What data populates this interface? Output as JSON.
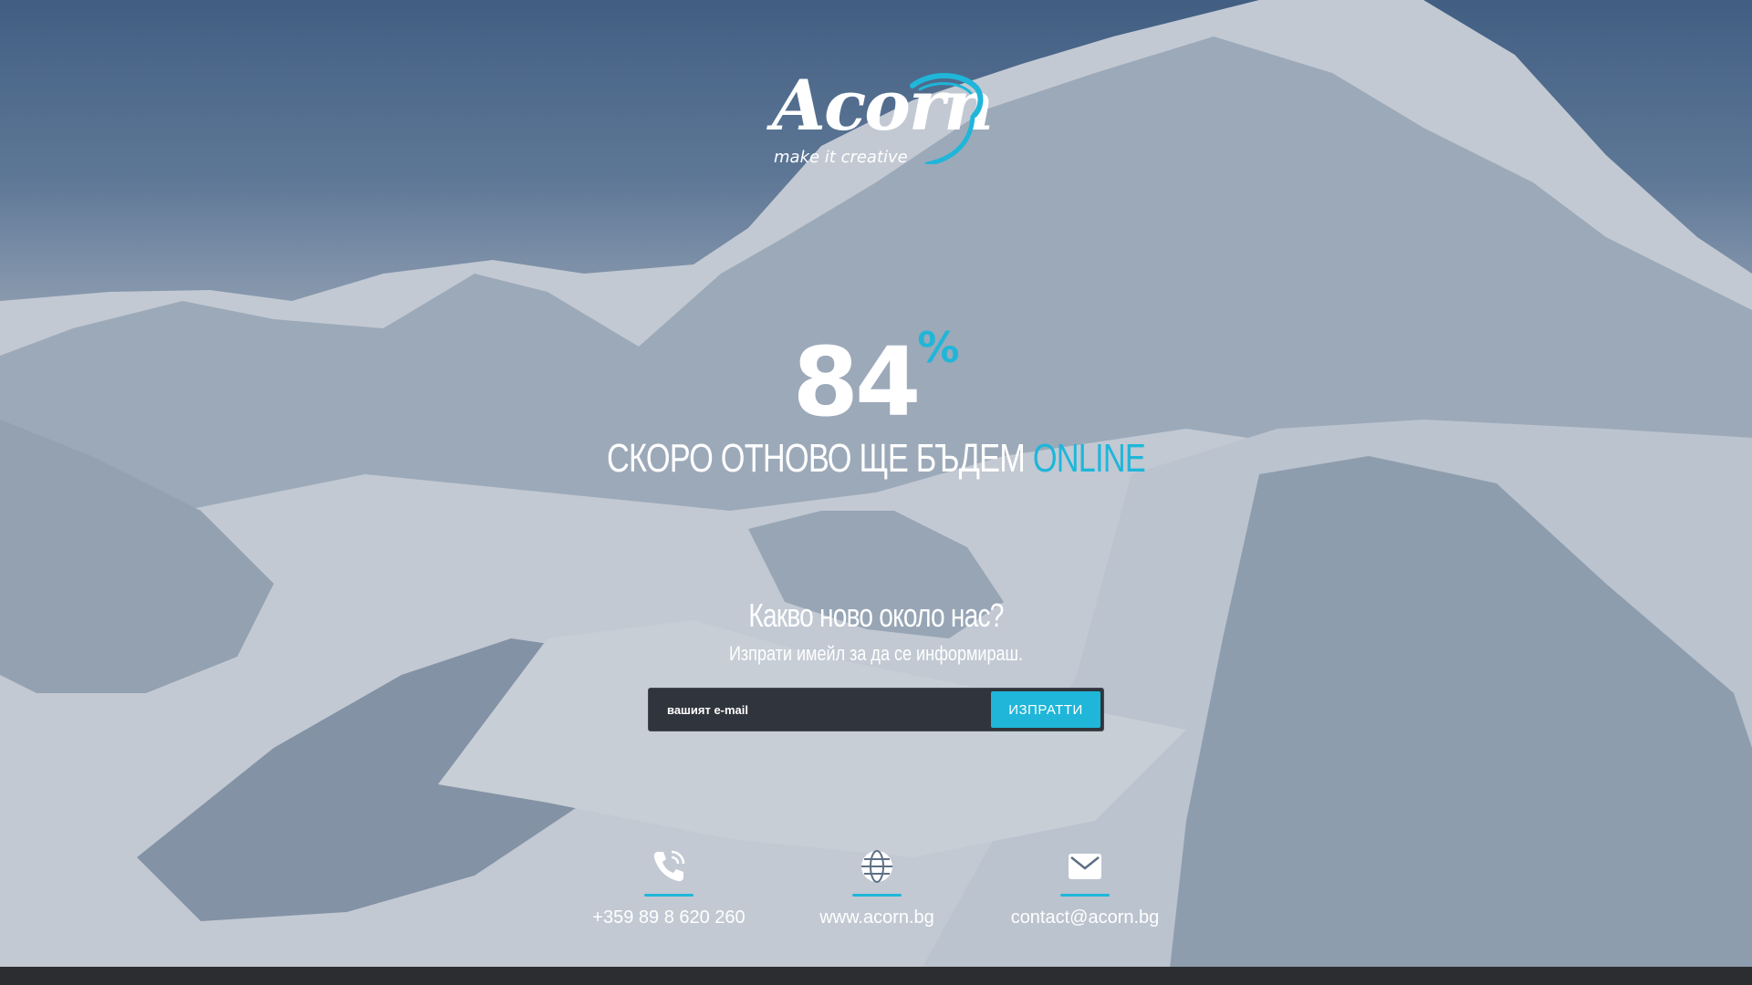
{
  "logo": {
    "name": "Acorn",
    "tagline": "make it creative"
  },
  "progress": {
    "value": "84",
    "unit": "%"
  },
  "headline": {
    "main": "СКОРО ОТНОВО ЩЕ БЪДЕМ",
    "accent": "ONLINE"
  },
  "newsletter": {
    "title": "Какво ново около нас?",
    "subtitle": "Изпрати имейл за да се информираш.",
    "placeholder": "вашият e-mail",
    "button": "ИЗПРАТТИ"
  },
  "contacts": {
    "phone": "+359 89 8 620 260",
    "website": "www.acorn.bg",
    "email": "contact@acorn.bg"
  },
  "colors": {
    "accent": "#1fb6d9",
    "form_bg": "#30343c",
    "footer_bar": "#2b2d31"
  }
}
